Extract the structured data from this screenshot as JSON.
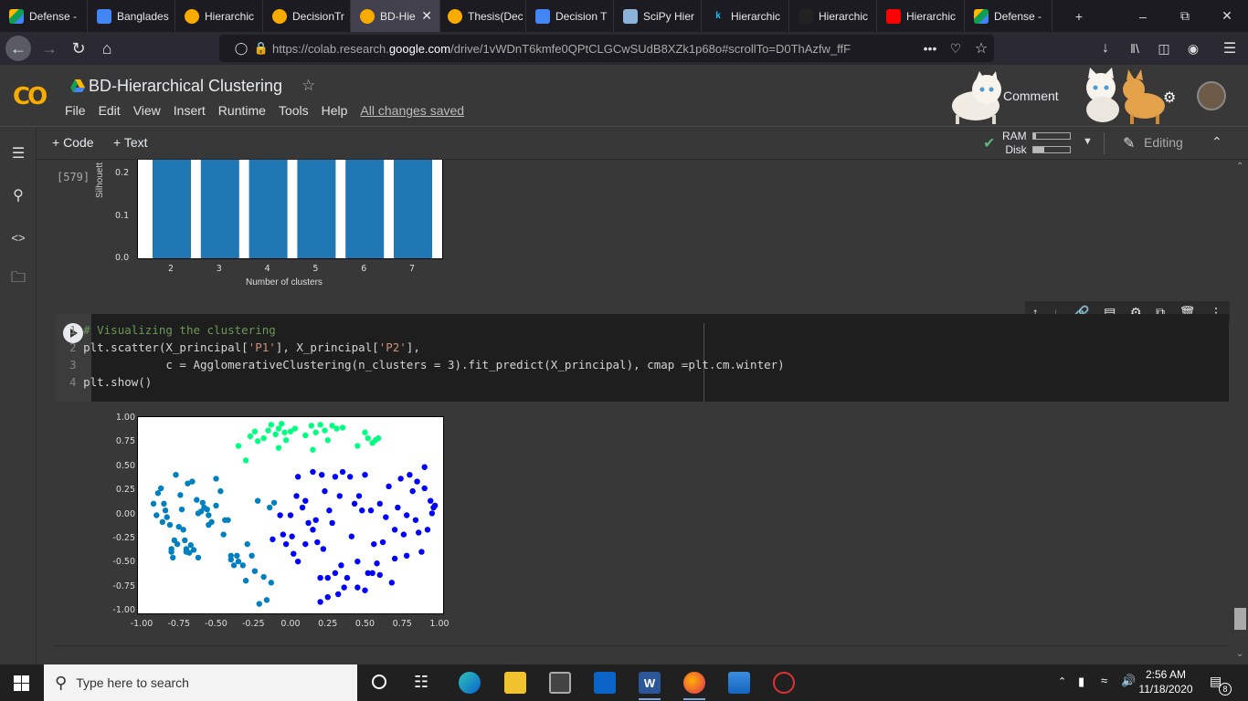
{
  "browser": {
    "tabs": [
      {
        "label": "Defense -",
        "icon": "drive-icon"
      },
      {
        "label": "Banglades",
        "icon": "docs-icon"
      },
      {
        "label": "Hierarchic",
        "icon": "colab-icon"
      },
      {
        "label": "DecisionTr",
        "icon": "colab-icon"
      },
      {
        "label": "BD-Hie",
        "icon": "colab-icon",
        "active": true
      },
      {
        "label": "Thesis(Dec",
        "icon": "colab-icon"
      },
      {
        "label": "Decision T",
        "icon": "docs-icon"
      },
      {
        "label": "SciPy Hier",
        "icon": "scipy-icon"
      },
      {
        "label": "Hierarchic",
        "icon": "kaggle-icon"
      },
      {
        "label": "Hierarchic",
        "icon": "sa-icon"
      },
      {
        "label": "Hierarchic",
        "icon": "youtube-icon"
      },
      {
        "label": "Defense -",
        "icon": "drive-icon"
      }
    ],
    "url_prefix": "https://colab.research.",
    "url_domain": "google.com",
    "url_suffix": "/drive/1vWDnT6kmfe0QPtCLGCwSUdB8XZk1p68o#scrollTo=D0ThAzfw_ffF"
  },
  "colab": {
    "logo": "CO",
    "title": "BD-Hierarchical Clustering",
    "menu": [
      "File",
      "Edit",
      "View",
      "Insert",
      "Runtime",
      "Tools",
      "Help"
    ],
    "saved_status": "All changes saved",
    "comment_label": "Comment",
    "add_code": "+ Code",
    "add_text": "+ Text",
    "ram_label": "RAM",
    "disk_label": "Disk",
    "ram_level": 0.08,
    "disk_level": 0.3,
    "editing_label": "Editing"
  },
  "prev_output": {
    "exec_count": "[579]",
    "ylabel_partial": "Silhouett",
    "chart_data": {
      "type": "bar",
      "categories": [
        "2",
        "3",
        "4",
        "5",
        "6",
        "7"
      ],
      "yticks": [
        "0.0",
        "0.1",
        "0.2"
      ],
      "xlabel": "Number of clusters",
      "ylabel": "Silhouett",
      "ylim_visible": [
        0,
        0.235
      ],
      "values": [
        0.235,
        0.235,
        0.235,
        0.235,
        0.235,
        0.235
      ],
      "bar_color": "#1f77b4"
    }
  },
  "code_cell": {
    "lines": [
      {
        "num": "1",
        "parts": [
          {
            "t": "# Visualizing the clustering",
            "c": "cmt"
          }
        ]
      },
      {
        "num": "2",
        "parts": [
          {
            "t": "plt.scatter(X_principal[",
            "c": ""
          },
          {
            "t": "'P1'",
            "c": "str"
          },
          {
            "t": "], X_principal[",
            "c": ""
          },
          {
            "t": "'P2'",
            "c": "str"
          },
          {
            "t": "],",
            "c": ""
          }
        ]
      },
      {
        "num": "3",
        "parts": [
          {
            "t": "            c = AgglomerativeClustering(n_clusters = 3).fit_predict(X_principal), cmap =plt.cm.winter)",
            "c": ""
          }
        ]
      },
      {
        "num": "4",
        "parts": [
          {
            "t": "plt.show()",
            "c": ""
          }
        ]
      }
    ]
  },
  "scatter_chart": {
    "chart_data": {
      "type": "scatter",
      "xticks": [
        "-1.00",
        "-0.75",
        "-0.50",
        "-0.25",
        "0.00",
        "0.25",
        "0.50",
        "0.75",
        "1.00"
      ],
      "yticks": [
        "-1.00",
        "-0.75",
        "-0.50",
        "-0.25",
        "0.00",
        "0.25",
        "0.50",
        "0.75",
        "1.00"
      ],
      "xlim": [
        -1.0,
        1.0
      ],
      "ylim": [
        -1.0,
        1.0
      ],
      "series": [
        {
          "color": "#00ff80",
          "points": [
            [
              -0.35,
              0.72
            ],
            [
              -0.27,
              0.82
            ],
            [
              -0.24,
              0.87
            ],
            [
              -0.22,
              0.77
            ],
            [
              -0.18,
              0.8
            ],
            [
              -0.15,
              0.88
            ],
            [
              -0.13,
              0.94
            ],
            [
              -0.1,
              0.84
            ],
            [
              -0.08,
              0.9
            ],
            [
              -0.06,
              0.95
            ],
            [
              -0.04,
              0.86
            ],
            [
              -0.03,
              0.78
            ],
            [
              0.0,
              0.87
            ],
            [
              0.03,
              0.9
            ],
            [
              0.1,
              0.83
            ],
            [
              0.14,
              0.93
            ],
            [
              0.17,
              0.86
            ],
            [
              0.2,
              0.94
            ],
            [
              0.23,
              0.88
            ],
            [
              0.25,
              0.78
            ],
            [
              0.28,
              0.93
            ],
            [
              0.31,
              0.9
            ],
            [
              0.35,
              0.91
            ],
            [
              0.45,
              0.72
            ],
            [
              0.5,
              0.86
            ],
            [
              0.52,
              0.8
            ],
            [
              0.55,
              0.75
            ],
            [
              0.57,
              0.78
            ],
            [
              0.59,
              0.8
            ],
            [
              -0.08,
              0.7
            ],
            [
              0.15,
              0.68
            ],
            [
              -0.3,
              0.57
            ]
          ]
        },
        {
          "color": "#0080c0",
          "points": [
            [
              -0.92,
              0.12
            ],
            [
              -0.89,
              0.23
            ],
            [
              -0.87,
              0.28
            ],
            [
              -0.85,
              0.12
            ],
            [
              -0.84,
              0.05
            ],
            [
              -0.83,
              -0.02
            ],
            [
              -0.81,
              -0.1
            ],
            [
              -0.8,
              -0.35
            ],
            [
              -0.79,
              -0.44
            ],
            [
              -0.78,
              -0.26
            ],
            [
              -0.77,
              0.42
            ],
            [
              -0.76,
              -0.3
            ],
            [
              -0.74,
              0.21
            ],
            [
              -0.73,
              0.06
            ],
            [
              -0.72,
              -0.15
            ],
            [
              -0.71,
              -0.26
            ],
            [
              -0.7,
              -0.38
            ],
            [
              -0.69,
              0.33
            ],
            [
              -0.68,
              -0.39
            ],
            [
              -0.67,
              -0.31
            ],
            [
              -0.66,
              0.35
            ],
            [
              -0.65,
              -0.36
            ],
            [
              -0.63,
              0.16
            ],
            [
              -0.62,
              -0.44
            ],
            [
              -0.6,
              0.04
            ],
            [
              -0.59,
              0.13
            ],
            [
              -0.58,
              0.08
            ],
            [
              -0.56,
              0.06
            ],
            [
              -0.55,
              0.0
            ],
            [
              -0.53,
              -0.07
            ],
            [
              -0.5,
              0.1
            ],
            [
              -0.47,
              0.25
            ],
            [
              -0.44,
              -0.05
            ],
            [
              -0.42,
              -0.05
            ],
            [
              -0.4,
              -0.46
            ],
            [
              -0.38,
              -0.52
            ],
            [
              -0.36,
              -0.42
            ],
            [
              -0.35,
              -0.48
            ],
            [
              -0.32,
              -0.52
            ],
            [
              -0.3,
              -0.68
            ],
            [
              -0.29,
              -0.3
            ],
            [
              -0.26,
              -0.42
            ],
            [
              -0.24,
              -0.58
            ],
            [
              -0.22,
              0.15
            ],
            [
              -0.21,
              -0.92
            ],
            [
              -0.18,
              -0.64
            ],
            [
              -0.16,
              -0.88
            ],
            [
              -0.14,
              0.08
            ],
            [
              -0.13,
              -0.7
            ],
            [
              -0.11,
              0.13
            ],
            [
              -0.9,
              0.0
            ],
            [
              -0.86,
              -0.07
            ],
            [
              -0.8,
              -0.38
            ],
            [
              -0.75,
              -0.12
            ],
            [
              -0.7,
              -0.35
            ],
            [
              -0.62,
              0.02
            ],
            [
              -0.5,
              0.38
            ],
            [
              -0.45,
              -0.2
            ],
            [
              -0.55,
              -0.1
            ],
            [
              -0.4,
              -0.42
            ]
          ]
        },
        {
          "color": "#0000ff",
          "points": [
            [
              -0.12,
              -0.25
            ],
            [
              -0.07,
              0.0
            ],
            [
              -0.05,
              -0.2
            ],
            [
              -0.03,
              -0.3
            ],
            [
              0.01,
              -0.22
            ],
            [
              0.02,
              -0.4
            ],
            [
              0.04,
              0.2
            ],
            [
              0.05,
              -0.48
            ],
            [
              0.08,
              0.08
            ],
            [
              0.1,
              -0.3
            ],
            [
              0.12,
              -0.08
            ],
            [
              0.15,
              -0.15
            ],
            [
              0.17,
              -0.05
            ],
            [
              0.18,
              -0.28
            ],
            [
              0.2,
              -0.65
            ],
            [
              0.21,
              0.42
            ],
            [
              0.22,
              -0.35
            ],
            [
              0.23,
              0.25
            ],
            [
              0.25,
              -0.65
            ],
            [
              0.26,
              0.05
            ],
            [
              0.28,
              -0.08
            ],
            [
              0.3,
              -0.6
            ],
            [
              0.32,
              -0.82
            ],
            [
              0.33,
              0.2
            ],
            [
              0.34,
              -0.52
            ],
            [
              0.36,
              -0.75
            ],
            [
              0.38,
              -0.65
            ],
            [
              0.4,
              0.4
            ],
            [
              0.41,
              -0.22
            ],
            [
              0.43,
              0.12
            ],
            [
              0.45,
              -0.48
            ],
            [
              0.46,
              0.2
            ],
            [
              0.48,
              0.05
            ],
            [
              0.5,
              -0.78
            ],
            [
              0.52,
              -0.6
            ],
            [
              0.54,
              0.05
            ],
            [
              0.56,
              -0.3
            ],
            [
              0.58,
              -0.5
            ],
            [
              0.6,
              0.12
            ],
            [
              0.62,
              -0.28
            ],
            [
              0.64,
              -0.02
            ],
            [
              0.66,
              0.3
            ],
            [
              0.68,
              -0.7
            ],
            [
              0.7,
              -0.15
            ],
            [
              0.72,
              0.08
            ],
            [
              0.74,
              0.38
            ],
            [
              0.76,
              -0.2
            ],
            [
              0.78,
              0.0
            ],
            [
              0.8,
              0.42
            ],
            [
              0.82,
              0.25
            ],
            [
              0.84,
              -0.05
            ],
            [
              0.86,
              -0.18
            ],
            [
              0.88,
              -0.38
            ],
            [
              0.9,
              0.28
            ],
            [
              0.92,
              -0.15
            ],
            [
              0.94,
              0.15
            ],
            [
              0.95,
              0.02
            ],
            [
              0.96,
              0.08
            ],
            [
              0.97,
              0.1
            ],
            [
              0.05,
              0.4
            ],
            [
              0.15,
              0.45
            ],
            [
              0.3,
              0.4
            ],
            [
              0.35,
              0.45
            ],
            [
              0.5,
              0.42
            ],
            [
              0.45,
              -0.75
            ],
            [
              0.2,
              -0.9
            ],
            [
              0.25,
              -0.85
            ],
            [
              0.55,
              -0.6
            ],
            [
              0.6,
              -0.62
            ],
            [
              0.7,
              -0.45
            ],
            [
              0.78,
              -0.42
            ],
            [
              0.85,
              0.35
            ],
            [
              0.9,
              0.5
            ],
            [
              0.1,
              0.15
            ],
            [
              0.0,
              0.0
            ]
          ]
        }
      ]
    }
  },
  "taskbar": {
    "search_placeholder": "Type here to search",
    "time": "2:56 AM",
    "date": "11/18/2020",
    "notif_count": "8"
  }
}
